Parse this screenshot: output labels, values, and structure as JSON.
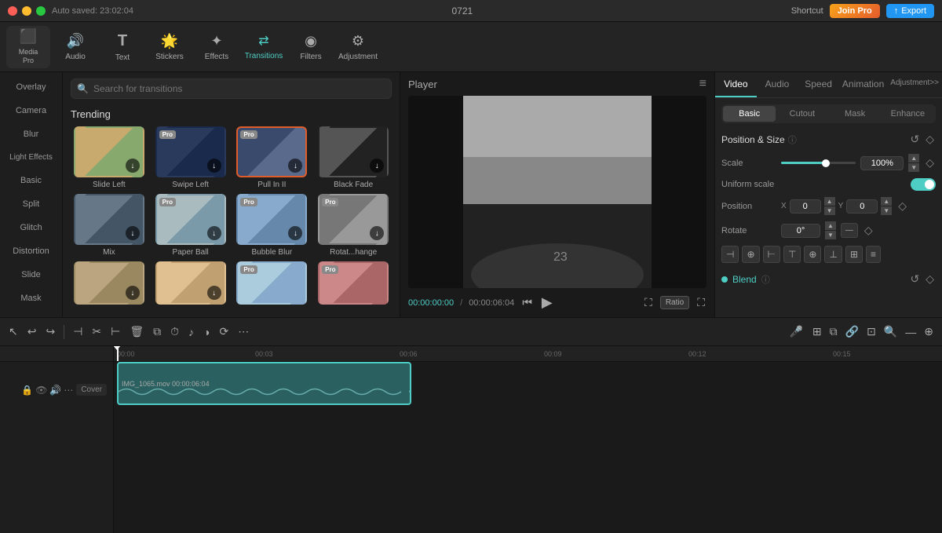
{
  "app": {
    "title": "0721",
    "autosave": "Auto saved: 23:02:04"
  },
  "window_buttons": {
    "close": "close",
    "minimize": "minimize",
    "maximize": "maximize"
  },
  "topbar": {
    "shortcut": "Shortcut",
    "join_pro": "Join Pro",
    "export": "Export"
  },
  "toolbar": {
    "items": [
      {
        "id": "media",
        "label": "Media\nPro",
        "icon": "🎬"
      },
      {
        "id": "audio",
        "label": "Audio",
        "icon": "🔊"
      },
      {
        "id": "text",
        "label": "Text",
        "icon": "T"
      },
      {
        "id": "stickers",
        "label": "Stickers",
        "icon": "⭐"
      },
      {
        "id": "effects",
        "label": "Effects",
        "icon": "✨"
      },
      {
        "id": "transitions",
        "label": "Transitions",
        "icon": "↔"
      },
      {
        "id": "filters",
        "label": "Filters",
        "icon": "🎨"
      },
      {
        "id": "adjustment",
        "label": "Adjustment",
        "icon": "⚙"
      }
    ]
  },
  "categories": [
    {
      "id": "overlay",
      "label": "Overlay"
    },
    {
      "id": "camera",
      "label": "Camera"
    },
    {
      "id": "blur",
      "label": "Blur"
    },
    {
      "id": "light",
      "label": "Light Effects"
    },
    {
      "id": "basic",
      "label": "Basic"
    },
    {
      "id": "split",
      "label": "Split"
    },
    {
      "id": "glitch",
      "label": "Glitch"
    },
    {
      "id": "distortion",
      "label": "Distortion"
    },
    {
      "id": "slide",
      "label": "Slide"
    },
    {
      "id": "mask",
      "label": "Mask"
    }
  ],
  "transitions": {
    "search_placeholder": "Search for transitions",
    "trending_label": "Trending",
    "items": [
      {
        "id": "slide-left",
        "name": "Slide Left",
        "pro": false,
        "selected": false
      },
      {
        "id": "swipe-left",
        "name": "Swipe Left",
        "pro": true,
        "selected": false
      },
      {
        "id": "pull-in",
        "name": "Pull In II",
        "pro": true,
        "selected": true
      },
      {
        "id": "black-fade",
        "name": "Black Fade",
        "pro": false,
        "selected": false
      },
      {
        "id": "mix",
        "name": "Mix",
        "pro": false,
        "selected": false
      },
      {
        "id": "paper-ball",
        "name": "Paper Ball",
        "pro": true,
        "selected": false
      },
      {
        "id": "bubble-blur",
        "name": "Bubble Blur",
        "pro": true,
        "selected": false
      },
      {
        "id": "rotat-change",
        "name": "Rotat...hange",
        "pro": true,
        "selected": false
      },
      {
        "id": "row3a",
        "name": "",
        "pro": false,
        "selected": false
      },
      {
        "id": "row3b",
        "name": "",
        "pro": false,
        "selected": false
      },
      {
        "id": "row3c",
        "name": "",
        "pro": true,
        "selected": false
      },
      {
        "id": "row3d",
        "name": "",
        "pro": true,
        "selected": false
      }
    ]
  },
  "player": {
    "title": "Player",
    "timecode_current": "00:00:00:00",
    "timecode_total": "00:00:06:04",
    "ratio_label": "Ratio"
  },
  "right_panel": {
    "tabs": [
      "Video",
      "Audio",
      "Speed",
      "Animation",
      "Adjustment>>"
    ],
    "basic_tabs": [
      "Basic",
      "Cutout",
      "Mask",
      "Enhance"
    ],
    "position_size": "Position & Size",
    "scale_label": "Scale",
    "scale_value": "100%",
    "uniform_scale": "Uniform scale",
    "position_label": "Position",
    "pos_x": "0",
    "pos_y": "0",
    "rotate_label": "Rotate",
    "rotate_value": "0°",
    "blend_label": "Blend"
  },
  "timeline": {
    "clips": [
      {
        "id": "clip1",
        "name": "IMG_1065.mov",
        "duration": "00:00:06:04"
      }
    ],
    "ruler_marks": [
      "00:00",
      "00:03",
      "00:06",
      "00:09",
      "00:12",
      "00:15"
    ],
    "track_label": "Cover"
  }
}
